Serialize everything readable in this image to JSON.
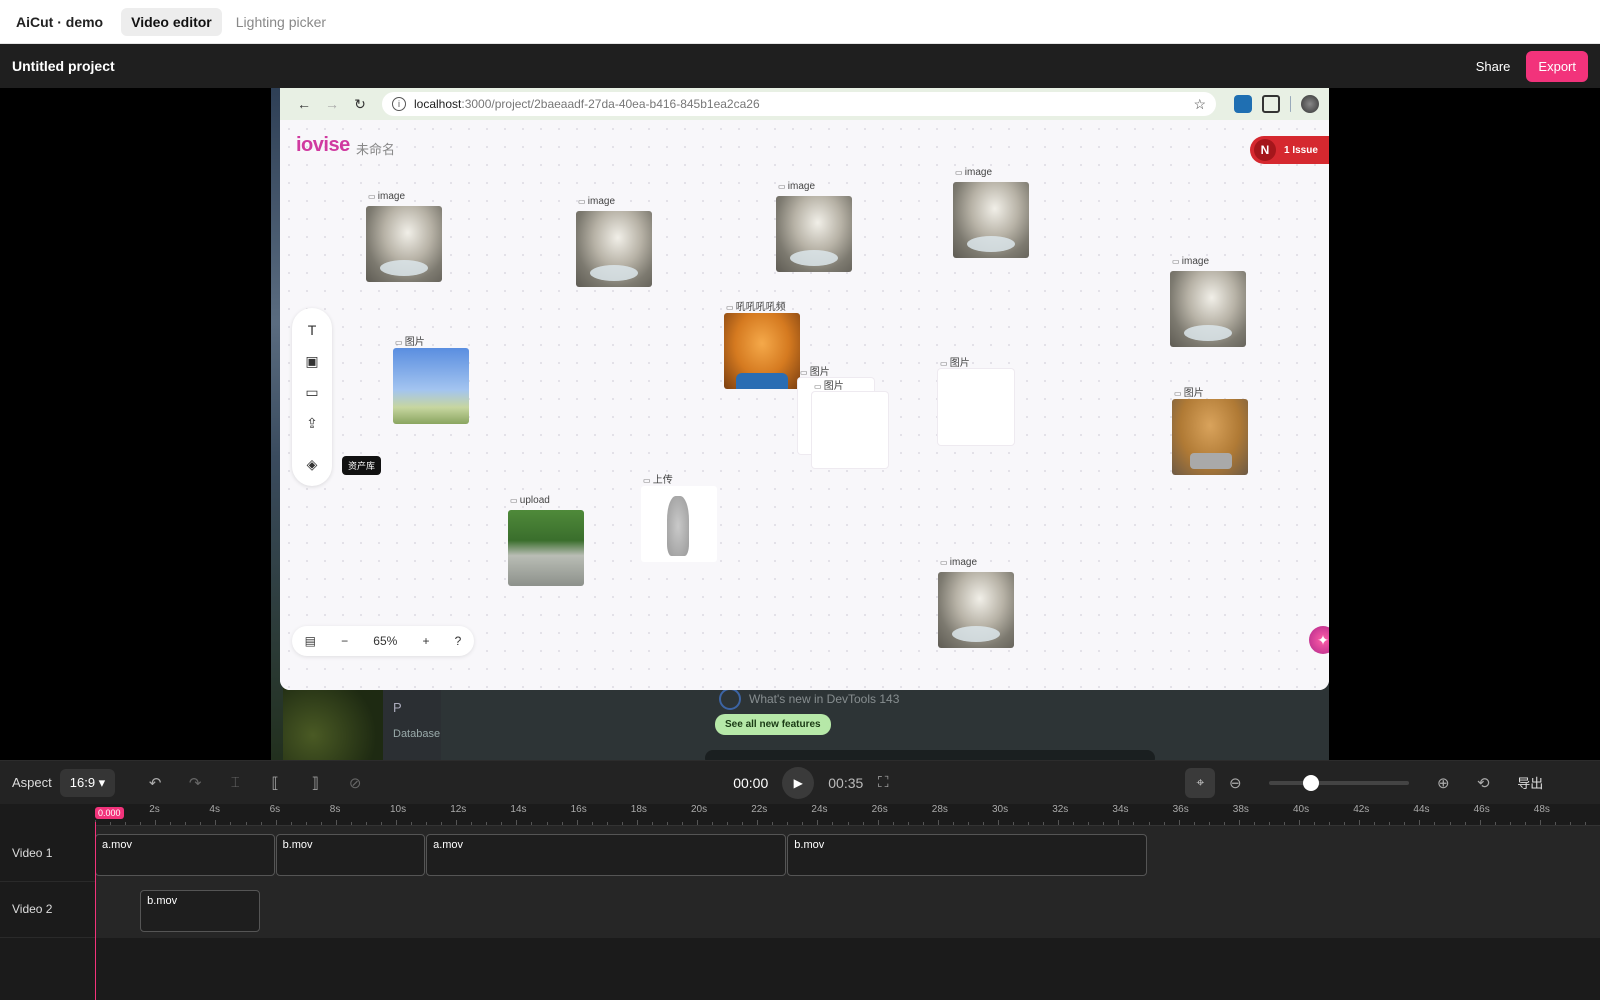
{
  "topnav": {
    "brand": "AiCut · demo",
    "tabs": [
      "Video editor",
      "Lighting picker"
    ]
  },
  "project": {
    "title": "Untitled project",
    "share": "Share",
    "export": "Export"
  },
  "browser": {
    "url_host": "localhost",
    "url_path": ":3000/project/2baeaadf-27da-40ea-b416-845b1ea2ca26",
    "logo": "iovise",
    "doc_name": "未命名",
    "issue_avatar": "N",
    "issue_label": "1 Issue",
    "nodes": [
      {
        "label": "image",
        "kind": "cat"
      },
      {
        "label": "image",
        "kind": "cat"
      },
      {
        "label": "image",
        "kind": "cat"
      },
      {
        "label": "image",
        "kind": "cat"
      },
      {
        "label": "image",
        "kind": "cat"
      },
      {
        "label": "图片",
        "kind": "sky"
      },
      {
        "label": "吼吼吼吼频",
        "kind": "kitten"
      },
      {
        "label": "图片",
        "kind": "blank"
      },
      {
        "label": "图片",
        "kind": "blank"
      },
      {
        "label": "图片",
        "kind": "blank"
      },
      {
        "label": "图片",
        "kind": "dog"
      },
      {
        "label": "upload",
        "kind": "man"
      },
      {
        "label": "上传",
        "kind": "figure"
      },
      {
        "label": "image",
        "kind": "cat"
      }
    ],
    "tool_tip": "资产库",
    "zoom": "65%",
    "background": {
      "devtools_text": "What's new in DevTools 143",
      "feature_button": "See all new features",
      "side_letter": "P",
      "side_label": "Database"
    }
  },
  "controls": {
    "aspect_label": "Aspect",
    "aspect_value": "16:9",
    "current_time": "00:00",
    "total_time": "00:35",
    "export_label": "导出",
    "zoom_level": 0.3
  },
  "timeline": {
    "playhead_time": "0.000",
    "ticks": [
      "2s",
      "4s",
      "6s",
      "8s",
      "10s",
      "12s",
      "14s",
      "16s",
      "18s",
      "20s",
      "22s",
      "24s",
      "26s",
      "28s",
      "30s",
      "32s",
      "34s",
      "36s",
      "38s",
      "40s",
      "42s",
      "44s",
      "46s",
      "48s"
    ],
    "tracks": [
      {
        "name": "Video 1",
        "clips": [
          {
            "name": "a.mov",
            "start": 0,
            "end": 6
          },
          {
            "name": "b.mov",
            "start": 6,
            "end": 11
          },
          {
            "name": "a.mov",
            "start": 11,
            "end": 23
          },
          {
            "name": "b.mov",
            "start": 23,
            "end": 35
          }
        ]
      },
      {
        "name": "Video 2",
        "clips": [
          {
            "name": "b.mov",
            "start": 1.5,
            "end": 5.5
          }
        ]
      }
    ]
  }
}
